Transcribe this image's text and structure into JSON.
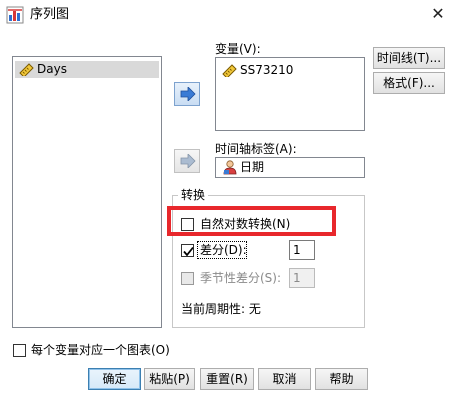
{
  "window": {
    "title": "序列图",
    "close_glyph": "✕"
  },
  "source_list": {
    "items": [
      {
        "label": "Days",
        "icon": "ruler-icon",
        "selected": true
      }
    ]
  },
  "variables": {
    "label": "变量(V):",
    "items": [
      {
        "label": "SS73210",
        "icon": "ruler-icon"
      }
    ]
  },
  "time_axis": {
    "label": "时间轴标签(A):",
    "value": "日期",
    "icon": "person-icon"
  },
  "side_buttons": {
    "time_lines": "时间线(T)...",
    "format": "格式(F)..."
  },
  "transform": {
    "title": "转换",
    "natural_log": {
      "label": "自然对数转换(N)",
      "checked": false
    },
    "difference": {
      "label": "差分(D):",
      "checked": true,
      "value": "1"
    },
    "seasonal_difference": {
      "label": "季节性差分(S):",
      "checked": false,
      "value": "1",
      "disabled": true
    },
    "current_period": "当前周期性: 无"
  },
  "one_chart_per_variable": {
    "label": "每个变量对应一个图表(O)",
    "checked": false
  },
  "footer": {
    "ok": "确定",
    "paste": "粘贴(P)",
    "reset": "重置(R)",
    "cancel": "取消",
    "help": "帮助"
  },
  "colors": {
    "highlight": "#e8272c",
    "arrow": "#3a7bd5",
    "selection": "#d9d9d9"
  }
}
